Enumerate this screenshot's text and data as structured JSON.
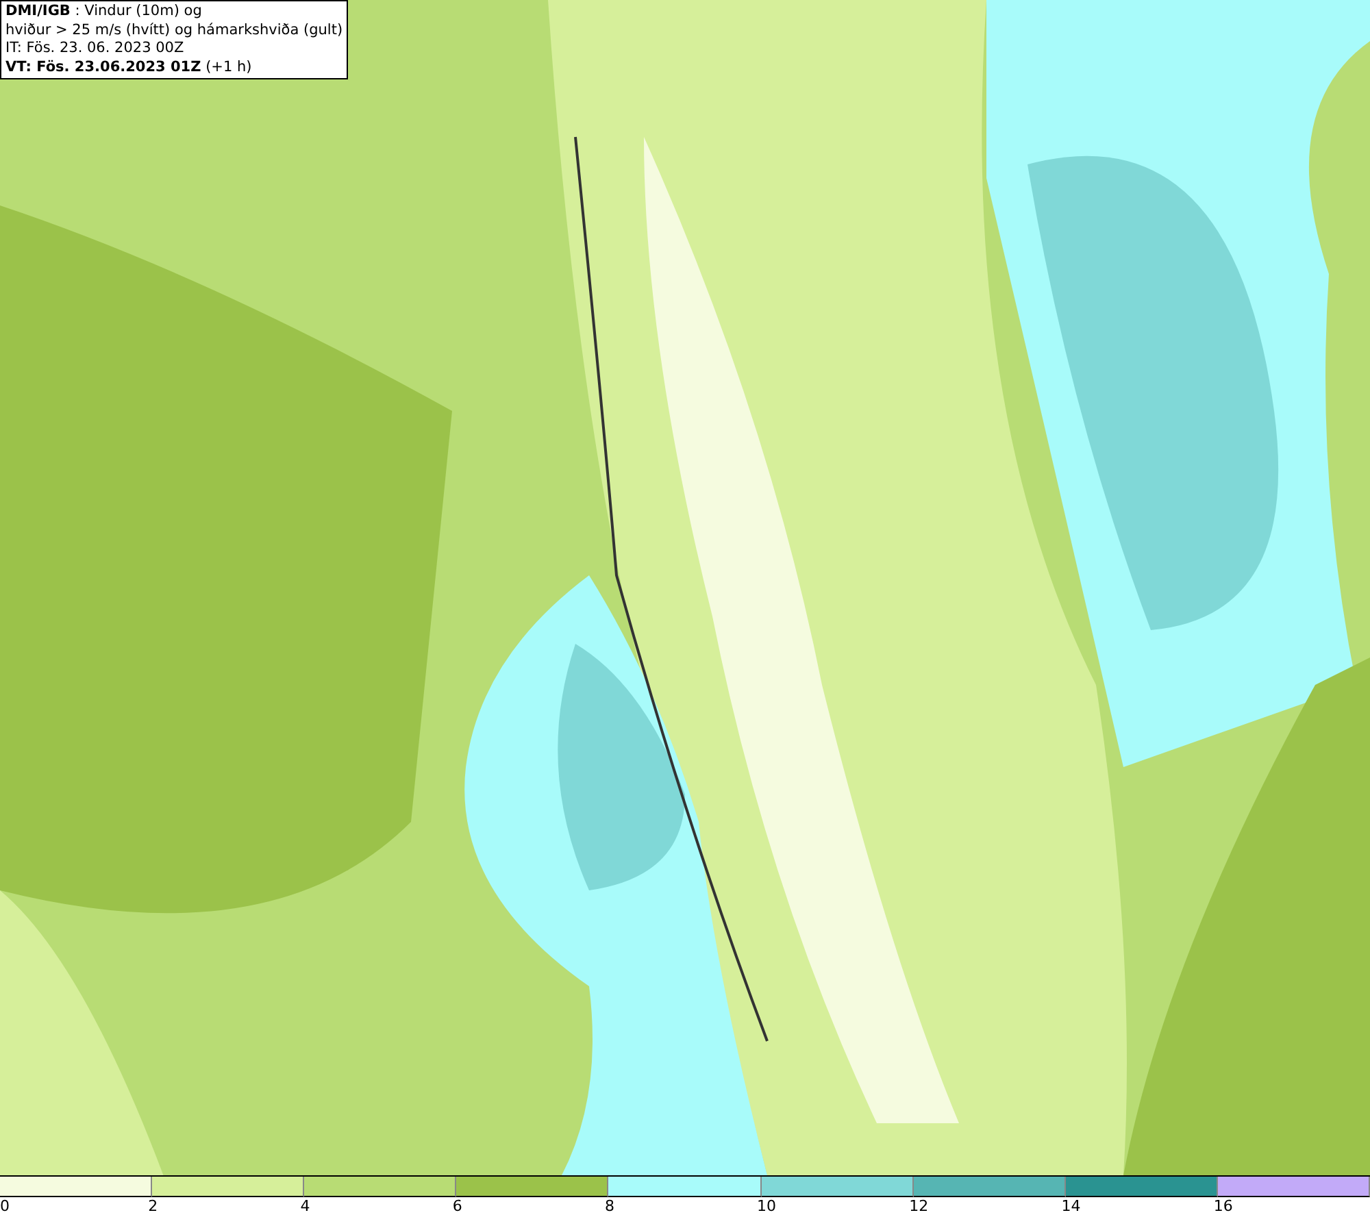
{
  "title_lines": [
    "**DMI/IGB** : Vindur (10m) og",
    "hviður > 25 m/s (hvítt) og hámarkshviða (gult)",
    "IT: Fös. 23. 06. 2023 00Z",
    "**VT: Fös. 23.06.2023 01Z** (+1 h)"
  ],
  "legend": [
    {
      "color": "#f5fbdf",
      "tick": "0"
    },
    {
      "color": "#d6ef9a",
      "tick": "2"
    },
    {
      "color": "#b8dc74",
      "tick": "4"
    },
    {
      "color": "#9bc24a",
      "tick": "6"
    },
    {
      "color": "#a8fbfa",
      "tick": "8"
    },
    {
      "color": "#80d8d7",
      "tick": "10"
    },
    {
      "color": "#56b5b3",
      "tick": "12"
    },
    {
      "color": "#2a9391",
      "tick": "14"
    },
    {
      "color": "#c2aaf8",
      "tick": "16"
    }
  ]
}
